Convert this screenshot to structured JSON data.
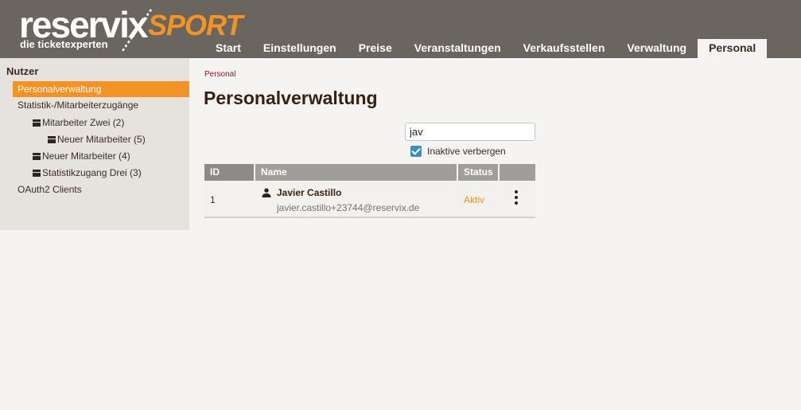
{
  "brand": {
    "logo_main": "reservix",
    "logo_sport": "SPORT",
    "logo_tagline": "die ticketexperten"
  },
  "nav": {
    "items": [
      {
        "label": "Start"
      },
      {
        "label": "Einstellungen"
      },
      {
        "label": "Preise"
      },
      {
        "label": "Veranstaltungen"
      },
      {
        "label": "Verkaufsstellen"
      },
      {
        "label": "Verwaltung"
      },
      {
        "label": "Personal"
      }
    ],
    "active": "Personal"
  },
  "sidebar": {
    "title": "Nutzer",
    "items": [
      {
        "label": "Personalverwaltung",
        "active": true
      },
      {
        "label": "Statistik-/Mitarbeiterzugänge"
      },
      {
        "label": "Mitarbeiter Zwei (2)",
        "icon": "folder-icon"
      },
      {
        "label": "Neuer Mitarbeiter (5)",
        "icon": "folder-icon"
      },
      {
        "label": "Neuer Mitarbeiter (4)",
        "icon": "folder-icon"
      },
      {
        "label": "Statistikzugang Drei (3)",
        "icon": "folder-icon"
      },
      {
        "label": "OAuth2 Clients"
      }
    ]
  },
  "main": {
    "breadcrumb": "Personal",
    "title": "Personalverwaltung",
    "search": {
      "value": "jav"
    },
    "hide_inactive": {
      "label": "Inaktive verbergen",
      "checked": true
    },
    "table": {
      "columns": [
        "ID",
        "Name",
        "Status",
        ""
      ],
      "rows": [
        {
          "id": "1",
          "name": "Javier Castillo",
          "email": "javier.castillo+23744@reservix.de",
          "status": "Aktiv",
          "icon": "user-icon",
          "actions_icon": "kebab-menu-icon"
        }
      ]
    }
  },
  "colors": {
    "header_bg": "#6b6560",
    "accent": "#f39325",
    "sidebar_bg": "#e6e3df",
    "checkbox": "#3b8fbf",
    "status_active": "#e8912a"
  }
}
